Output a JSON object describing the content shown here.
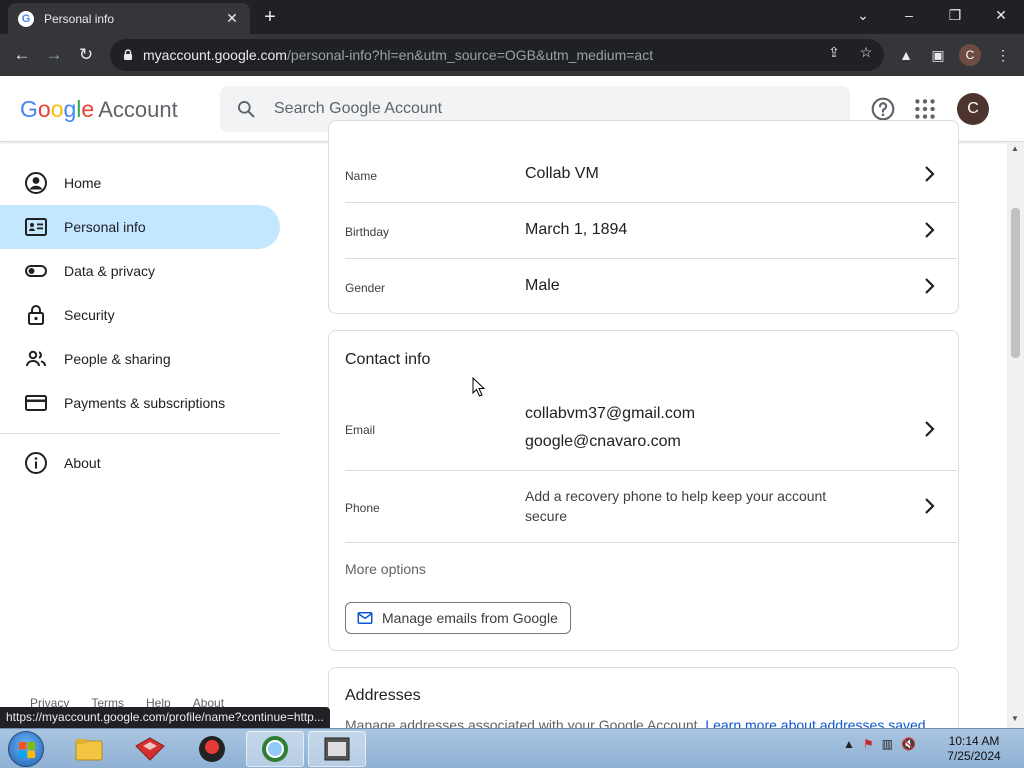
{
  "browser": {
    "tab_title": "Personal info",
    "favicon_letter": "G",
    "url_host": "myaccount.google.com",
    "url_path": "/personal-info?hl=en&utm_source=OGB&utm_medium=act",
    "profile_letter": "C"
  },
  "header": {
    "logo": {
      "g1": "G",
      "g2": "o",
      "g3": "o",
      "g4": "g",
      "g5": "l",
      "g6": "e",
      "suffix": "Account"
    },
    "search_placeholder": "Search Google Account",
    "avatar_letter": "C"
  },
  "sidebar": {
    "items": [
      {
        "label": "Home",
        "icon": "account-circle-icon"
      },
      {
        "label": "Personal info",
        "icon": "id-card-icon",
        "active": true
      },
      {
        "label": "Data & privacy",
        "icon": "toggle-icon"
      },
      {
        "label": "Security",
        "icon": "lock-icon"
      },
      {
        "label": "People & sharing",
        "icon": "people-icon"
      },
      {
        "label": "Payments & subscriptions",
        "icon": "credit-card-icon"
      },
      {
        "label": "About",
        "icon": "info-icon"
      }
    ],
    "footer": [
      "Privacy",
      "Terms",
      "Help",
      "About"
    ]
  },
  "basic_info": {
    "rows": [
      {
        "label": "Name",
        "value": "Collab VM"
      },
      {
        "label": "Birthday",
        "value": "March 1, 1894"
      },
      {
        "label": "Gender",
        "value": "Male"
      }
    ]
  },
  "contact_info": {
    "title": "Contact info",
    "email_label": "Email",
    "emails": [
      "collabvm37@gmail.com",
      "google@cnavaro.com"
    ],
    "phone_label": "Phone",
    "phone_value_line1": "Add a recovery phone to help keep your account",
    "phone_value_line2": "secure",
    "more_options": "More options",
    "manage_button": "Manage emails from Google"
  },
  "addresses": {
    "title": "Addresses",
    "description": "Manage addresses associated with your Google Account.",
    "link": "Learn more about addresses saved"
  },
  "status_bar": "https://myaccount.google.com/profile/name?continue=http...",
  "taskbar": {
    "time": "10:14 AM",
    "date": "7/25/2024"
  },
  "colors": {
    "accent": "#c2e7ff",
    "link": "#0b57d0",
    "chrome_dark": "#202124"
  }
}
